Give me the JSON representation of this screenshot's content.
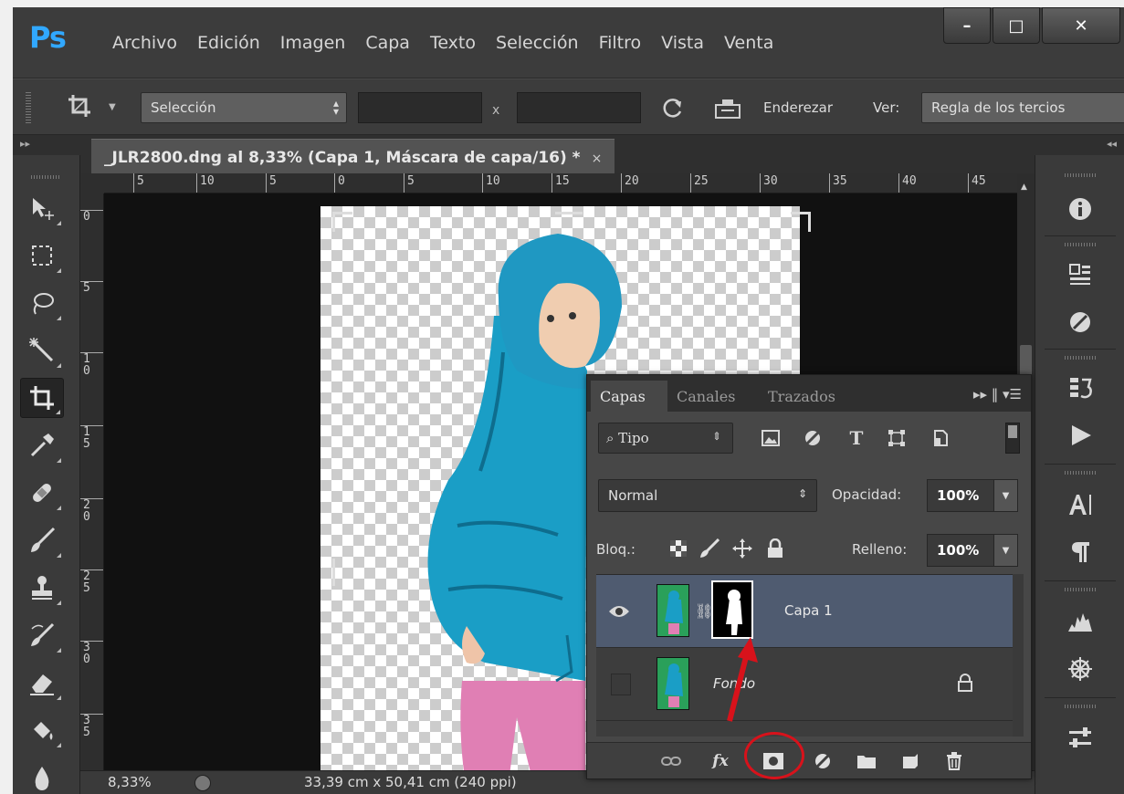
{
  "app": {
    "logo": "Ps",
    "menu": [
      "Archivo",
      "Edición",
      "Imagen",
      "Capa",
      "Texto",
      "Selección",
      "Filtro",
      "Vista",
      "Venta"
    ],
    "window_controls": {
      "minimize": "–",
      "maximize": "□",
      "close": "✕"
    }
  },
  "options": {
    "preset": "Selección",
    "width_value": "",
    "height_value": "",
    "separator": "x",
    "straighten_label": "Enderezar",
    "view_label": "Ver:",
    "view_value": "Regla de los tercios"
  },
  "document": {
    "tab_title": "_JLR2800.dng al 8,33% (Capa 1, Máscara de capa/16) *",
    "tab_close": "×",
    "ruler_h": [
      "5",
      "10",
      "5",
      "0",
      "5",
      "10",
      "15",
      "20",
      "25",
      "30",
      "35",
      "40",
      "45"
    ],
    "ruler_v": [
      "0",
      "5",
      "1\n0",
      "1\n5",
      "2\n0",
      "2\n5",
      "3\n0",
      "3\n5"
    ]
  },
  "status": {
    "zoom": "8,33%",
    "doc_size": "33,39 cm x 50,41 cm (240 ppi)"
  },
  "layers_panel": {
    "tabs": [
      "Capas",
      "Canales",
      "Trazados"
    ],
    "active_tab": "Capas",
    "filter_kind": "Tipo",
    "blend_mode": "Normal",
    "opacity_label": "Opacidad:",
    "opacity_value": "100%",
    "lock_label": "Bloq.:",
    "fill_label": "Relleno:",
    "fill_value": "100%",
    "layers": [
      {
        "name": "Capa 1",
        "visible": true,
        "selected": true,
        "has_mask": true
      },
      {
        "name": "Fondo",
        "visible": false,
        "selected": false,
        "locked": true
      }
    ],
    "footer_fx": "fx"
  },
  "colors": {
    "accent": "#31a8ff",
    "selected_layer": "#4f5b70",
    "annotation": "#d8121b",
    "panel_bg": "#474747"
  }
}
